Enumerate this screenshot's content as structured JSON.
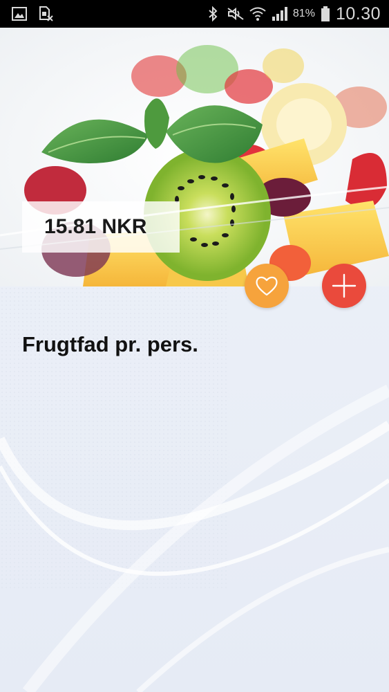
{
  "status_bar": {
    "battery": "81%",
    "time": "10.30",
    "icons": [
      "gallery-icon",
      "sim-card-x-icon",
      "bluetooth-icon",
      "mute-icon",
      "wifi-icon",
      "signal-icon",
      "battery-icon"
    ]
  },
  "product": {
    "price": "15.81 NKR",
    "title": "Frugtfad pr. pers."
  },
  "actions": {
    "favorite_icon": "heart-outline-icon",
    "add_icon": "plus-icon",
    "favorite_color": "#f6a33c",
    "add_color": "#ea4a3c"
  }
}
